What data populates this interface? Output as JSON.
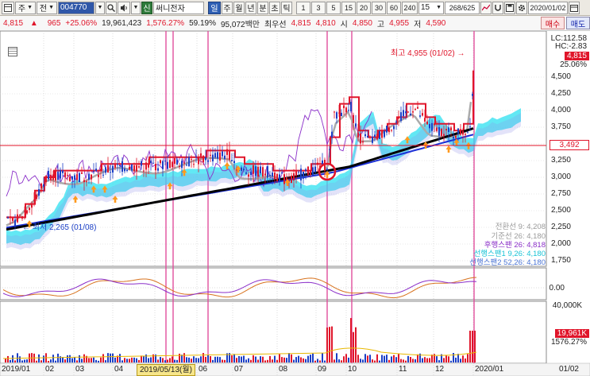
{
  "toolbar": {
    "market_a": "주",
    "market_b": "전",
    "code": "004770",
    "credit_badge": "신",
    "stock_name": "써니전자",
    "periods": [
      "일",
      "주",
      "월",
      "년",
      "분",
      "초",
      "틱"
    ],
    "active_period": "일",
    "intervals": [
      "1",
      "3",
      "5",
      "15",
      "20",
      "30",
      "60",
      "240"
    ],
    "interval_value": "15",
    "page_counter": "268/625",
    "date": "2020/01/02"
  },
  "quote": {
    "price": "4,815",
    "change": "965",
    "change_pct": "+25.06%",
    "volume": "19,961,423",
    "volume_pct": "1,576.27%",
    "rate": "59.19%",
    "amount": "95,072백만",
    "first_label": "최우선",
    "best_ask": "4,815",
    "best_bid": "4,810",
    "open_label": "시",
    "open": "4,850",
    "high_label": "고",
    "high": "4,955",
    "low_label": "저",
    "low": "4,590",
    "buy_label": "매수",
    "sell_label": "매도"
  },
  "price_panel": {
    "lc": "LC:112.58",
    "hc": "HC:-2.83",
    "current_tag": "4,815",
    "pct_label": "25.06%",
    "level_tag": "3,492",
    "high_annotation": "최고 4,955 (01/02)",
    "low_annotation": "최저 2,265 (01/08)",
    "y_ticks": [
      "4,500",
      "4,250",
      "4,000",
      "3,750",
      "3,500",
      "3,250",
      "3,000",
      "2,750",
      "2,500",
      "2,250",
      "2,000",
      "1,750"
    ],
    "legend": [
      {
        "text": "전환선 9: 4,208",
        "color": "#9a9a9a"
      },
      {
        "text": "기준선 26: 4,180",
        "color": "#9a9a9a"
      },
      {
        "text": "후행스팬 26: 4,818",
        "color": "#8b2fc9"
      },
      {
        "text": "선행스팬1 9,26: 4,180",
        "color": "#18c3d6"
      },
      {
        "text": "선행스팬2 52,26: 4,180",
        "color": "#4a74d6"
      }
    ]
  },
  "oscillator_panel": {
    "y_tick": "0.00"
  },
  "volume_panel": {
    "y_tick": "40,000K",
    "volume_tag": "19,961K",
    "volume_pct": "1576.27%"
  },
  "x_axis": {
    "labels": [
      "2019/01",
      "02",
      "03",
      "04",
      "05",
      "06",
      "07",
      "08",
      "09",
      "10",
      "11",
      "12",
      "2020/01"
    ],
    "cursor_label": "2019/05/13(월)",
    "right_label": "01/02"
  },
  "colors": {
    "up": "#e0152a",
    "down": "#1b3fc6",
    "ma": "#000000",
    "cloud_a": "#2ee0f0",
    "cloud_b": "#8f90e8",
    "trend_red": "#e0152a",
    "trend_blue": "#1b2fd6",
    "accent": "#e04a9a"
  }
}
